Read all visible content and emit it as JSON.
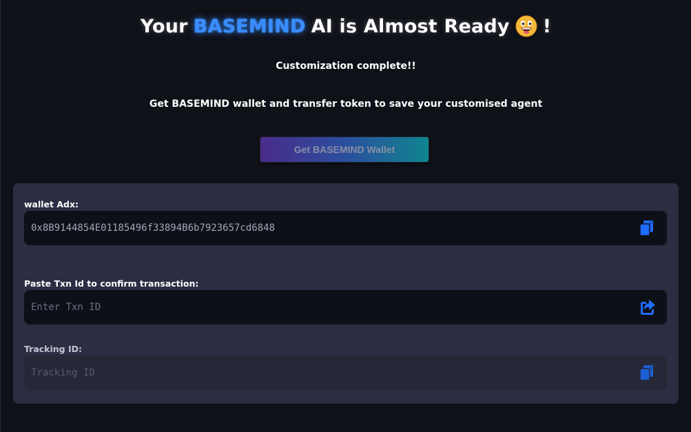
{
  "header": {
    "title_prefix": "Your",
    "brand": "BASEMIND",
    "title_suffix": "AI is Almost Ready",
    "title_end": "!",
    "emoji_icon": "grinning-face-emoji"
  },
  "subtitle": "Customization complete!!",
  "instruction": "Get BASEMIND wallet and transfer token to save your customised agent",
  "wallet_button": {
    "label": "Get BASEMIND Wallet"
  },
  "form": {
    "wallet": {
      "label": "wallet Adx:",
      "value": "0x8B9144854E01185496f33894B6b7923657cd6848",
      "action_icon": "copy-icon"
    },
    "txn": {
      "label": "Paste Txn Id to confirm transaction:",
      "placeholder": "Enter Txn ID",
      "action_icon": "share-icon"
    },
    "tracking": {
      "label": "Tracking ID:",
      "placeholder": "Tracking ID",
      "action_icon": "copy-icon"
    }
  },
  "colors": {
    "background": "#0f1118",
    "panel": "#2b2d42",
    "field": "#0e1017",
    "accent": "#3a8dff",
    "icon": "#1f6bff"
  }
}
